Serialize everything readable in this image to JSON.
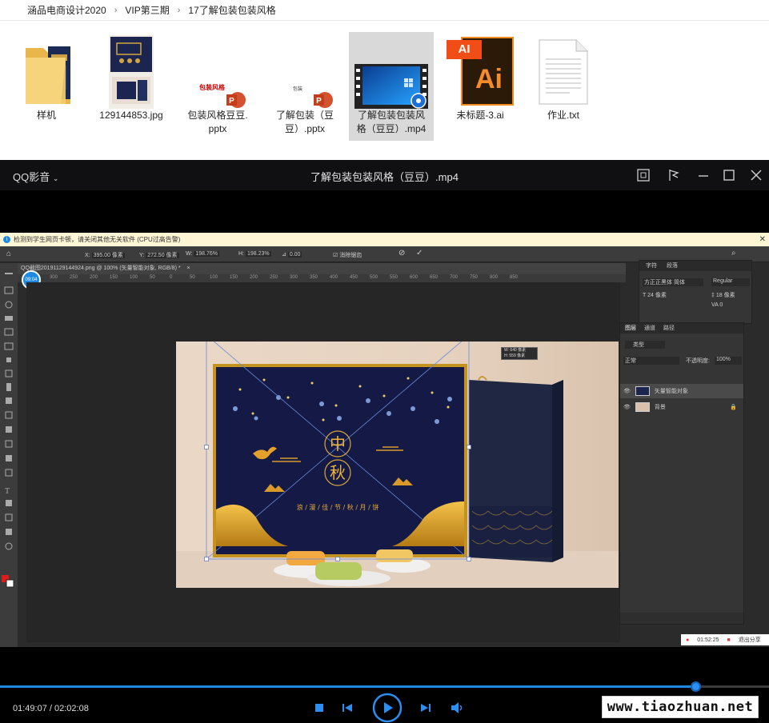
{
  "explorer": {
    "breadcrumb": [
      "涵品电商设计2020",
      "VIP第三期",
      "17了解包装包装风格"
    ],
    "files": [
      {
        "name": "样机",
        "icon": "folder-icon"
      },
      {
        "name": "129144853.jpg",
        "icon": "image-thumbnail"
      },
      {
        "name_lines": [
          "包装风格豆豆.",
          "pptx"
        ],
        "icon": "pptx-icon",
        "thumb_text": "包装风格"
      },
      {
        "name_lines": [
          "了解包装（豆",
          "豆）.pptx"
        ],
        "icon": "pptx-icon",
        "thumb_text": "包装"
      },
      {
        "name_lines": [
          "了解包装包装风",
          "格（豆豆）.mp4"
        ],
        "icon": "video-icon",
        "selected": true
      },
      {
        "name": "未标题-3.ai",
        "icon": "ai-icon",
        "ai_text": "Ai",
        "ai_badge": "AI"
      },
      {
        "name": "作业.txt",
        "icon": "txt-icon"
      }
    ]
  },
  "player": {
    "app_name": "QQ影音",
    "video_title": "了解包装包装风格（豆豆）.mp4",
    "elapsed": "01:49:07",
    "duration": "02:02:08",
    "progress": 0.904,
    "watermark": "www.tiaozhuan.net"
  },
  "video_frame": {
    "notice": "检测到学生网页卡顿，请关闭其他无关软件 (CPU过高告警)",
    "doc_tab": "QQ截图20191129144924.png @ 100% (矢量智能对象, RGB/8) *",
    "timestamp_badge": "09:04",
    "toolbar_fields": {
      "x": "395.00 像素",
      "y": "272.50 像素",
      "w": "198.76%",
      "h": "198.23%",
      "angle": "0.00",
      "interp": "消除锯齿"
    },
    "ruler_ticks": [
      "300",
      "250",
      "200",
      "150",
      "100",
      "50",
      "0",
      "50",
      "100",
      "150",
      "200",
      "250",
      "300",
      "350",
      "400",
      "450",
      "500",
      "550",
      "600",
      "650",
      "700",
      "750",
      "800",
      "850"
    ],
    "size_tooltip": [
      "W: 640 像素",
      "H: 559 像素"
    ],
    "artwork_text": {
      "zhong": "中",
      "qiu": "秋",
      "subtitle": "浪 / 漫 / 佳 / 节 / 秋 / 月 / 饼"
    },
    "char_panel": {
      "tabs": [
        "字符",
        "段落"
      ],
      "font": "方正正黑体 简体",
      "style": "Regular",
      "size": "24 像素",
      "leading": "18 像素",
      "tracking": "0"
    },
    "layers_panel": {
      "tabs": [
        "图层",
        "通道",
        "路径"
      ],
      "search": "类型",
      "blend": "正常",
      "opacity_label": "不透明度:",
      "opacity": "100%",
      "layers": [
        "矢量智能对象",
        "背景"
      ]
    },
    "recording": {
      "time": "01:52:25",
      "exit": "退出分享"
    }
  }
}
